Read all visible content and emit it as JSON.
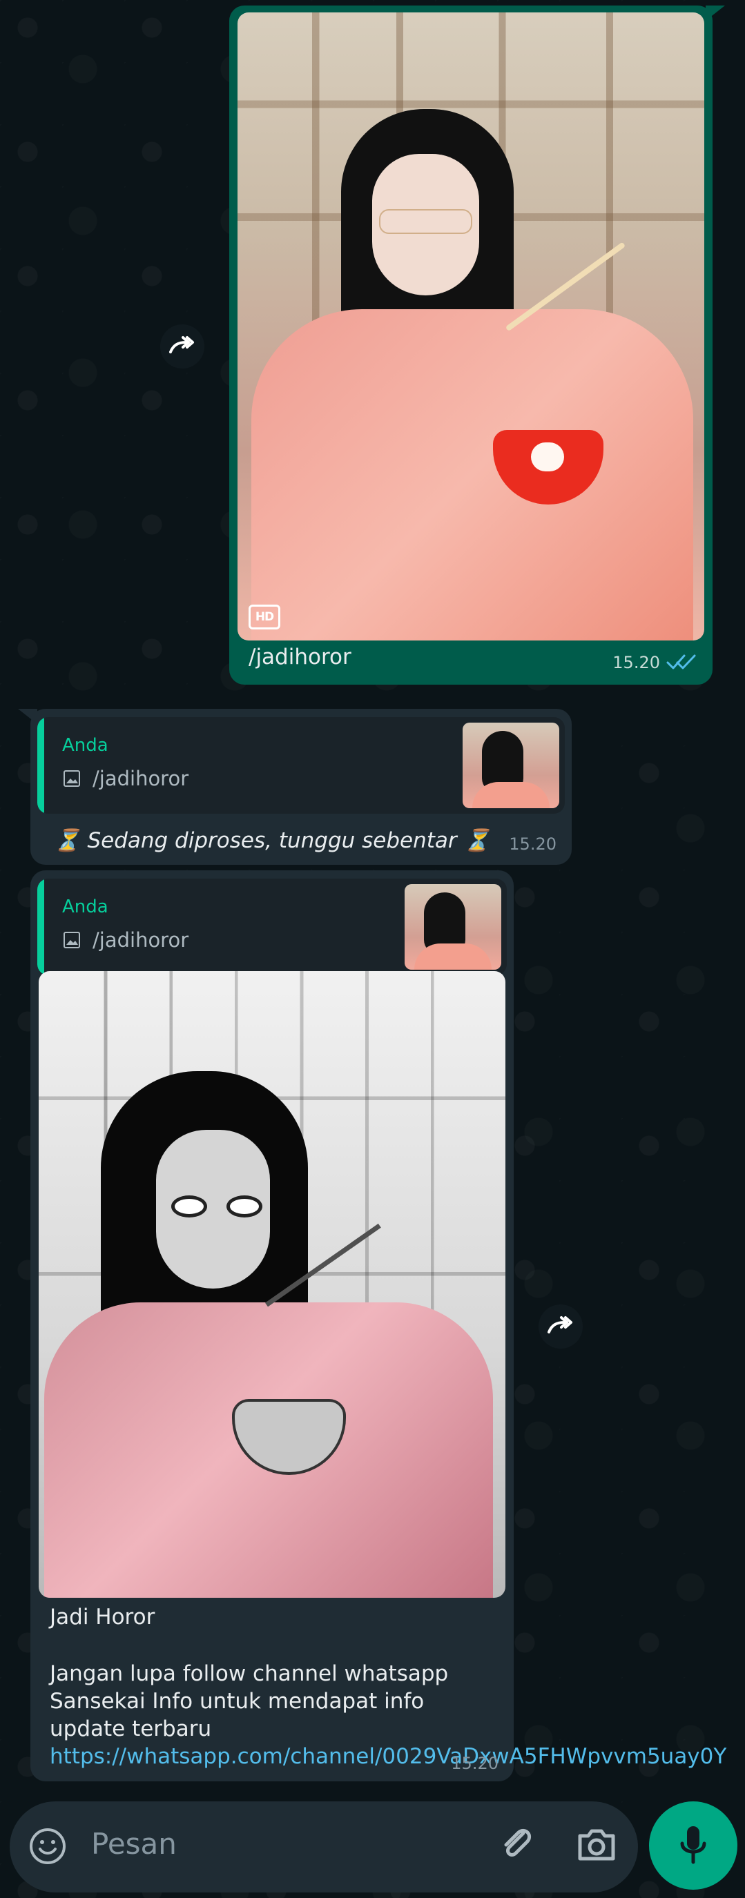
{
  "theme": {
    "accent": "#00a884",
    "outgoing_bubble": "#005c4b",
    "incoming_bubble": "#1f2c34",
    "link": "#53bdeb"
  },
  "outgoing_message": {
    "caption": "/jadihoror",
    "time": "15.20",
    "badge": "HD",
    "status_icon": "double-check-icon"
  },
  "incoming_message_1": {
    "reply_sender": "Anda",
    "reply_text": "/jadihoror",
    "reply_icon": "image-icon",
    "text": "⏳ Sedang diproses, tunggu sebentar ⏳",
    "time": "15.20"
  },
  "incoming_message_2": {
    "reply_sender": "Anda",
    "reply_text": "/jadihoror",
    "reply_icon": "image-icon",
    "title": "Jadi Horor",
    "body_text": "Jangan lupa follow channel whatsapp Sansekai Info untuk mendapat info update terbaru ",
    "link": "https://whatsapp.com/channel/0029VaDxwA5FHWpvvm5uay0Y",
    "time": "15.20"
  },
  "composer": {
    "placeholder": "Pesan",
    "emoji_icon": "emoji-icon",
    "attach_icon": "paperclip-icon",
    "camera_icon": "camera-icon",
    "mic_icon": "mic-icon"
  },
  "icons": {
    "forward": "forward-icon"
  }
}
